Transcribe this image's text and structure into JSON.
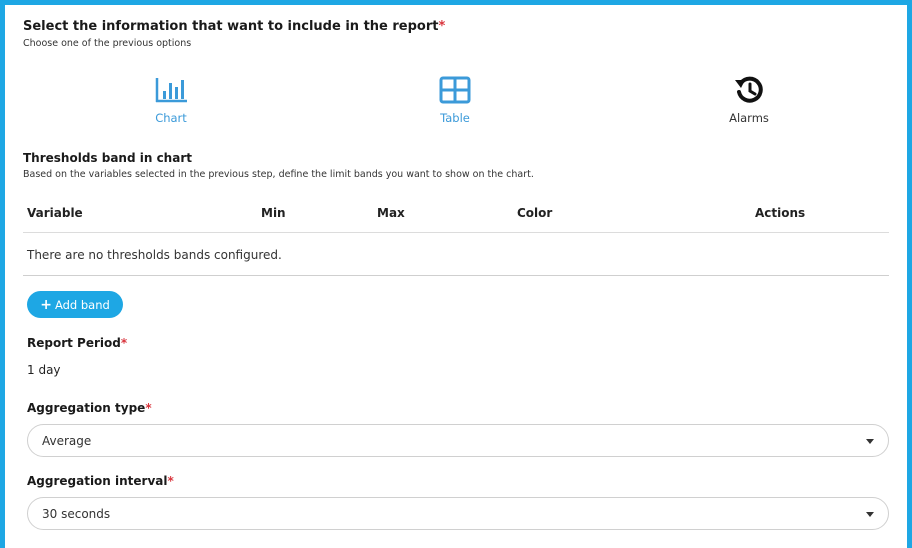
{
  "report_info": {
    "title": "Select the information that want to include in the report",
    "required_mark": "*",
    "subtitle": "Choose one of the previous options"
  },
  "options": [
    {
      "label": "Chart",
      "icon": "bar-chart-icon",
      "color": "#3b9ad9"
    },
    {
      "label": "Table",
      "icon": "table-icon",
      "color": "#3b9ad9"
    },
    {
      "label": "Alarms",
      "icon": "history-icon",
      "color": "#222222"
    }
  ],
  "thresholds": {
    "title": "Thresholds band in chart",
    "subtitle": "Based on the variables selected in the previous step, define the limit bands you want to show on the chart.",
    "columns": [
      "Variable",
      "Min",
      "Max",
      "Color",
      "Actions"
    ],
    "empty_message": "There are no thresholds bands configured.",
    "add_button": "Add band",
    "add_icon": "plus-icon"
  },
  "report_period": {
    "label": "Report Period",
    "required_mark": "*",
    "value": "1 day"
  },
  "aggregation_type": {
    "label": "Aggregation type",
    "required_mark": "*",
    "value": "Average"
  },
  "aggregation_interval": {
    "label": "Aggregation interval",
    "required_mark": "*",
    "value": "30 seconds"
  },
  "colors": {
    "accent": "#1ea7e4",
    "icon_blue": "#3b9ad9",
    "required": "#d9363e"
  }
}
